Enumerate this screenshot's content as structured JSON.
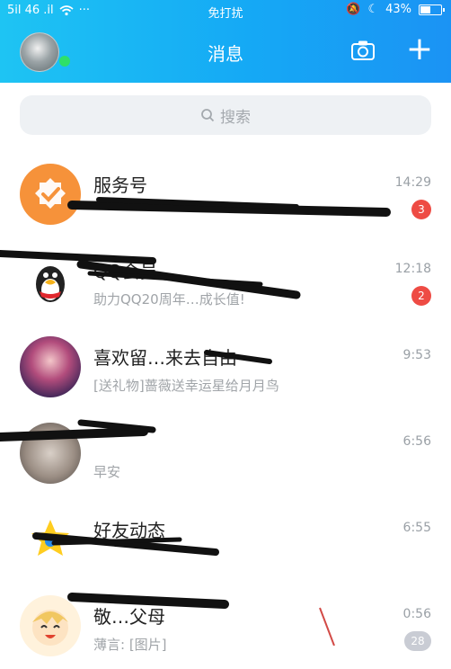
{
  "status_bar": {
    "signal_text": "5il 46 .il",
    "wifi_icon": "wifi-icon",
    "more_dots": "···",
    "mode": "免打扰",
    "battery": "43%"
  },
  "header": {
    "title": "消息",
    "camera_icon": "camera-icon",
    "add_icon": "plus-icon"
  },
  "search": {
    "placeholder": "搜索"
  },
  "conversations": [
    {
      "name": "服务号",
      "preview": "",
      "time": "14:29",
      "badge": "3",
      "avatar": "service-avatar-orange"
    },
    {
      "name": "QQ会员",
      "preview": "助力QQ20周年…成长值!",
      "time": "12:18",
      "badge": "2",
      "avatar": "qq-penguin-avatar"
    },
    {
      "name": "喜欢留…来去自由",
      "preview": "[送礼物]蔷薇送幸运星给月月鸟",
      "time": "9:53",
      "badge": "",
      "avatar": "anime-girl-avatar"
    },
    {
      "name": "",
      "preview": "早安",
      "time": "6:56",
      "badge": "",
      "avatar": "photo-avatar"
    },
    {
      "name": "好友动态",
      "preview": "",
      "time": "6:55",
      "badge": "",
      "avatar": "star-avatar"
    },
    {
      "name": "敬…父母",
      "preview": "薄言: [图片]",
      "time": "0:56",
      "badge": "28",
      "avatar": "cartoon-avatar"
    }
  ]
}
